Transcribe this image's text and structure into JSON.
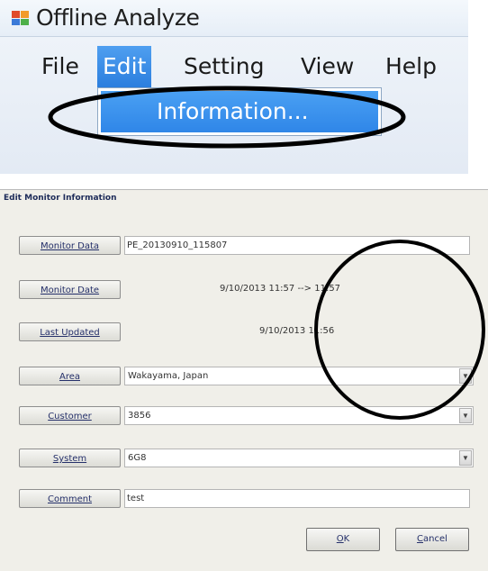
{
  "app": {
    "title": "Offline Analyze"
  },
  "menubar": {
    "items": [
      {
        "label": "File"
      },
      {
        "label": "Edit"
      },
      {
        "label": "Setting"
      },
      {
        "label": "View"
      },
      {
        "label": "Help"
      }
    ],
    "active": "Edit",
    "dropdown": {
      "items": [
        {
          "label": "Information..."
        }
      ]
    }
  },
  "dialog": {
    "title": "Edit Monitor Information",
    "fields": {
      "monitor_data": {
        "label": "Monitor Data",
        "value": "PE_20130910_115807"
      },
      "monitor_date": {
        "label": "Monitor Date",
        "value": "9/10/2013 11:57 --> 11:57"
      },
      "last_updated": {
        "label": "Last Updated",
        "value": "9/10/2013 11:56"
      },
      "area": {
        "label": "Area",
        "value": "Wakayama, Japan"
      },
      "customer": {
        "label": "Customer",
        "value": "3856"
      },
      "system": {
        "label": "System",
        "value": "6G8"
      },
      "comment": {
        "label": "Comment",
        "value": "test"
      }
    },
    "buttons": {
      "ok": {
        "mnemonic": "O",
        "rest": "K"
      },
      "cancel": {
        "mnemonic": "C",
        "rest": "ancel"
      }
    }
  },
  "colors": {
    "menu_highlight": "#2f86e8",
    "dialog_bg": "#f0efe9",
    "annotation": "#000000"
  },
  "icons": [
    "app-icon",
    "dropdown-arrow-icon"
  ]
}
